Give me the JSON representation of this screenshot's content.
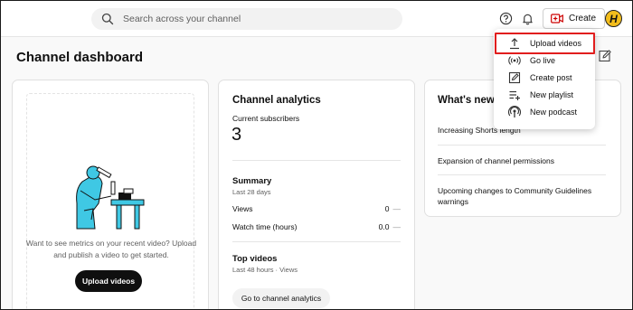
{
  "search": {
    "placeholder": "Search across your channel"
  },
  "header": {
    "create_label": "Create",
    "avatar_letter": "H"
  },
  "page": {
    "title": "Channel dashboard"
  },
  "upload_card": {
    "text": "Want to see metrics on your recent video? Upload and publish a video to get started.",
    "button_label": "Upload videos"
  },
  "analytics": {
    "title": "Channel analytics",
    "subscribers_label": "Current subscribers",
    "subscribers_count": "3",
    "summary_title": "Summary",
    "summary_period": "Last 28 days",
    "stats": [
      {
        "label": "Views",
        "value": "0",
        "change": "—"
      },
      {
        "label": "Watch time (hours)",
        "value": "0.0",
        "change": "—"
      }
    ],
    "top_videos_title": "Top videos",
    "top_videos_period": "Last 48 hours · Views",
    "button_label": "Go to channel analytics"
  },
  "whats_new": {
    "title": "What's new in",
    "items": [
      "Increasing Shorts length",
      "Expansion of channel permissions",
      "Upcoming changes to Community Guidelines warnings"
    ]
  },
  "create_menu": {
    "items": [
      {
        "label": "Upload videos",
        "icon": "upload-icon"
      },
      {
        "label": "Go live",
        "icon": "live-icon"
      },
      {
        "label": "Create post",
        "icon": "post-icon"
      },
      {
        "label": "New playlist",
        "icon": "playlist-icon"
      },
      {
        "label": "New podcast",
        "icon": "podcast-icon"
      }
    ],
    "highlight_color": "#e11d1d"
  },
  "colors": {
    "accent": "#0f0f0f",
    "avatar_bg": "#f2bd1d",
    "illustration": "#3fc8e4"
  }
}
